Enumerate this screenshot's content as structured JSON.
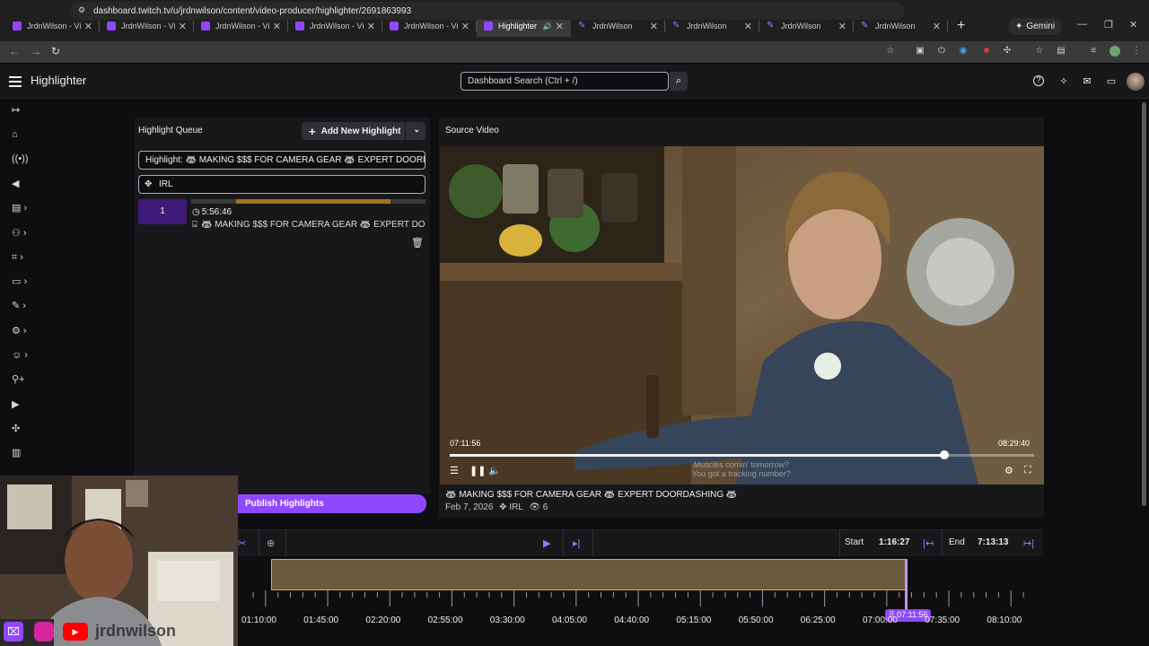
{
  "browser": {
    "tabs": [
      {
        "title": "JrdnWilson - Vid",
        "active": false,
        "icon": "twitch-icon"
      },
      {
        "title": "JrdnWilson - Vid",
        "active": false,
        "icon": "twitch-icon"
      },
      {
        "title": "JrdnWilson - Vid",
        "active": false,
        "icon": "twitch-icon"
      },
      {
        "title": "JrdnWilson - Vid",
        "active": false,
        "icon": "twitch-icon"
      },
      {
        "title": "JrdnWilson - Vid",
        "active": false,
        "icon": "twitch-icon"
      },
      {
        "title": "Highlighter",
        "active": true,
        "icon": "twitch-icon"
      },
      {
        "title": "JrdnWilson",
        "active": false,
        "icon": "pencil-icon"
      },
      {
        "title": "JrdnWilson",
        "active": false,
        "icon": "pencil-icon"
      },
      {
        "title": "JrdnWilson",
        "active": false,
        "icon": "pencil-icon"
      },
      {
        "title": "JrdnWilson",
        "active": false,
        "icon": "pencil-icon"
      }
    ],
    "gemini_label": "Gemini",
    "url": "dashboard.twitch.tv/u/jrdnwilson/content/video-producer/highlighter/2691863993"
  },
  "header": {
    "title": "Highlighter",
    "search_placeholder": "Dashboard Search (Ctrl + /)"
  },
  "queue": {
    "title": "Highlight Queue",
    "add_button": "Add New Highlight",
    "title_field": "Highlight: 🦝 MAKING $$$ FOR CAMERA GEAR 🦝 EXPERT DOORDASHING 🦝",
    "category_field": "IRL",
    "item": {
      "number": "1",
      "duration": "5:56:46",
      "description": "🦝 MAKING $$$ FOR CAMERA GEAR 🦝 EXPERT DO...",
      "range_start": 0.19,
      "range_end": 0.85
    },
    "publish_button": "Publish Highlights"
  },
  "source": {
    "title": "Source Video",
    "current_time": "07:11:56",
    "total_time": "08:29:40",
    "progress": 0.847,
    "subtitle_line1": "Muscles comin' tomorrow?",
    "subtitle_line2": "You got a tracking number?",
    "video_title": "🦝 MAKING $$$ FOR CAMERA GEAR 🦝 EXPERT DOORDASHING 🦝",
    "date": "Feb 7, 2026",
    "category": "IRL",
    "views": "6"
  },
  "timeline": {
    "start_label": "Start",
    "start_value": "1:16:27",
    "end_label": "End",
    "end_value": "7:13:13",
    "playhead_label": "07:11:56",
    "ticks": [
      "01:10:00",
      "01:45:00",
      "02:20:00",
      "02:55:00",
      "03:30:00",
      "04:05:00",
      "04:40:00",
      "05:15:00",
      "05:50:00",
      "06:25:00",
      "07:00:00",
      "07:35:00",
      "08:10:00"
    ]
  },
  "colors": {
    "accent": "#9147ff",
    "selection": "#6b5b3c",
    "selection_border": "#d5b04a",
    "clip_progress": "#a27224"
  },
  "webcam": {
    "overlay_text": "jrdnwilson"
  }
}
